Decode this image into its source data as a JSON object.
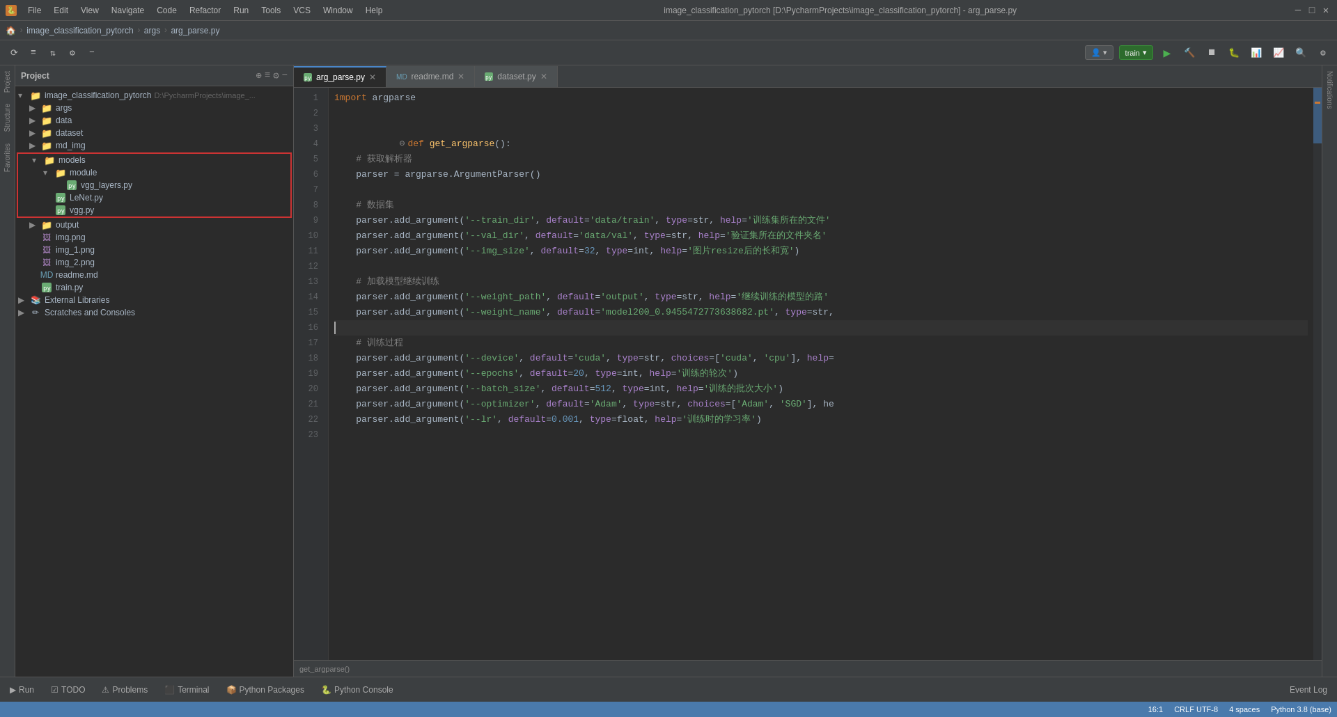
{
  "window": {
    "title": "image_classification_pytorch [D:\\PycharmProjects\\image_classification_pytorch] - arg_parse.py",
    "icon": "🐍"
  },
  "menus": [
    "File",
    "Edit",
    "View",
    "Navigate",
    "Code",
    "Refactor",
    "Run",
    "Tools",
    "VCS",
    "Window",
    "Help"
  ],
  "breadcrumb": {
    "items": [
      "image_classification_pytorch",
      "args",
      "arg_parse.py"
    ]
  },
  "toolbar": {
    "run_config": "train",
    "buttons": [
      "▶",
      "🔄",
      "⏹",
      "🐛",
      "📊"
    ]
  },
  "tabs": [
    {
      "label": "arg_parse.py",
      "active": true,
      "icon": "py"
    },
    {
      "label": "readme.md",
      "active": false,
      "icon": "md"
    },
    {
      "label": "dataset.py",
      "active": false,
      "icon": "py"
    }
  ],
  "project": {
    "title": "Project",
    "root": {
      "name": "image_classification_pytorch",
      "path": "D:\\PycharmProjects\\image_...",
      "children": [
        {
          "name": "args",
          "type": "folder",
          "expanded": false
        },
        {
          "name": "data",
          "type": "folder",
          "expanded": false
        },
        {
          "name": "dataset",
          "type": "folder",
          "expanded": false
        },
        {
          "name": "md_img",
          "type": "folder",
          "expanded": false
        },
        {
          "name": "models",
          "type": "folder",
          "expanded": true,
          "highlighted": true,
          "children": [
            {
              "name": "module",
              "type": "folder",
              "expanded": true,
              "children": [
                {
                  "name": "vgg_layers.py",
                  "type": "py"
                }
              ]
            },
            {
              "name": "LeNet.py",
              "type": "py"
            },
            {
              "name": "vgg.py",
              "type": "py"
            }
          ]
        },
        {
          "name": "output",
          "type": "folder",
          "expanded": false
        },
        {
          "name": "img.png",
          "type": "png"
        },
        {
          "name": "img_1.png",
          "type": "png"
        },
        {
          "name": "img_2.png",
          "type": "png"
        },
        {
          "name": "readme.md",
          "type": "md"
        },
        {
          "name": "train.py",
          "type": "py"
        }
      ]
    },
    "external_libraries": "External Libraries",
    "scratches": "Scratches and Consoles"
  },
  "code": {
    "lines": [
      {
        "num": 1,
        "content": "import argparse",
        "tokens": [
          {
            "t": "kw",
            "v": "import"
          },
          {
            "t": "plain",
            "v": " argparse"
          }
        ]
      },
      {
        "num": 2,
        "content": "",
        "tokens": []
      },
      {
        "num": 3,
        "content": "",
        "tokens": []
      },
      {
        "num": 4,
        "content": "def get_argparse():",
        "tokens": [
          {
            "t": "kw",
            "v": "def"
          },
          {
            "t": "plain",
            "v": " "
          },
          {
            "t": "fn",
            "v": "get_argparse"
          },
          {
            "t": "plain",
            "v": "():"
          }
        ]
      },
      {
        "num": 5,
        "content": "    # 获取解析器",
        "tokens": [
          {
            "t": "plain",
            "v": "    "
          },
          {
            "t": "cmt",
            "v": "# 获取解析器"
          }
        ]
      },
      {
        "num": 6,
        "content": "    parser = argparse.ArgumentParser()",
        "tokens": [
          {
            "t": "plain",
            "v": "    parser = argparse.ArgumentParser()"
          }
        ]
      },
      {
        "num": 7,
        "content": "",
        "tokens": []
      },
      {
        "num": 8,
        "content": "    # 数据集",
        "tokens": [
          {
            "t": "plain",
            "v": "    "
          },
          {
            "t": "cmt",
            "v": "# 数据集"
          }
        ]
      },
      {
        "num": 9,
        "content": "    parser.add_argument('--train_dir', default='data/train', type=str, help='训练集所在的文件'",
        "tokens": [
          {
            "t": "plain",
            "v": "    parser.add_argument("
          },
          {
            "t": "str",
            "v": "'--train_dir'"
          },
          {
            "t": "plain",
            "v": ", "
          },
          {
            "t": "param",
            "v": "default"
          },
          {
            "t": "plain",
            "v": "="
          },
          {
            "t": "str",
            "v": "'data/train'"
          },
          {
            "t": "plain",
            "v": ", "
          },
          {
            "t": "param",
            "v": "type"
          },
          {
            "t": "plain",
            "v": "=str, "
          },
          {
            "t": "param",
            "v": "help"
          },
          {
            "t": "plain",
            "v": "="
          },
          {
            "t": "str",
            "v": "'训练集所在的文件'"
          }
        ]
      },
      {
        "num": 10,
        "content": "    parser.add_argument('--val_dir', default='data/val', type=str, help='验证集所在的文件夹名'",
        "tokens": [
          {
            "t": "plain",
            "v": "    parser.add_argument("
          },
          {
            "t": "str",
            "v": "'--val_dir'"
          },
          {
            "t": "plain",
            "v": ", "
          },
          {
            "t": "param",
            "v": "default"
          },
          {
            "t": "plain",
            "v": "="
          },
          {
            "t": "str",
            "v": "'data/val'"
          },
          {
            "t": "plain",
            "v": ", "
          },
          {
            "t": "param",
            "v": "type"
          },
          {
            "t": "plain",
            "v": "=str, "
          },
          {
            "t": "param",
            "v": "help"
          },
          {
            "t": "plain",
            "v": "="
          },
          {
            "t": "str",
            "v": "'验证集所在的文件夹名'"
          }
        ]
      },
      {
        "num": 11,
        "content": "    parser.add_argument('--img_size', default=32, type=int, help='图片resize后的长和宽')",
        "tokens": [
          {
            "t": "plain",
            "v": "    parser.add_argument("
          },
          {
            "t": "str",
            "v": "'--img_size'"
          },
          {
            "t": "plain",
            "v": ", "
          },
          {
            "t": "param",
            "v": "default"
          },
          {
            "t": "plain",
            "v": "="
          },
          {
            "t": "num",
            "v": "32"
          },
          {
            "t": "plain",
            "v": ", "
          },
          {
            "t": "param",
            "v": "type"
          },
          {
            "t": "plain",
            "v": "=int, "
          },
          {
            "t": "param",
            "v": "help"
          },
          {
            "t": "plain",
            "v": "="
          },
          {
            "t": "str",
            "v": "'图片resize后的长和宽'"
          },
          {
            "t": "plain",
            "v": ")"
          }
        ]
      },
      {
        "num": 12,
        "content": "",
        "tokens": []
      },
      {
        "num": 13,
        "content": "    # 加载模型继续训练",
        "tokens": [
          {
            "t": "plain",
            "v": "    "
          },
          {
            "t": "cmt",
            "v": "# 加载模型继续训练"
          }
        ]
      },
      {
        "num": 14,
        "content": "    parser.add_argument('--weight_path', default='output', type=str, help='继续训练的模型的路'",
        "tokens": [
          {
            "t": "plain",
            "v": "    parser.add_argument("
          },
          {
            "t": "str",
            "v": "'--weight_path'"
          },
          {
            "t": "plain",
            "v": ", "
          },
          {
            "t": "param",
            "v": "default"
          },
          {
            "t": "plain",
            "v": "="
          },
          {
            "t": "str",
            "v": "'output'"
          },
          {
            "t": "plain",
            "v": ", "
          },
          {
            "t": "param",
            "v": "type"
          },
          {
            "t": "plain",
            "v": "=str, "
          },
          {
            "t": "param",
            "v": "help"
          },
          {
            "t": "plain",
            "v": "="
          },
          {
            "t": "str",
            "v": "'继续训练的模型的路'"
          }
        ]
      },
      {
        "num": 15,
        "content": "    parser.add_argument('--weight_name', default='model200_0.9455472773638682.pt', type=str,",
        "tokens": [
          {
            "t": "plain",
            "v": "    parser.add_argument("
          },
          {
            "t": "str",
            "v": "'--weight_name'"
          },
          {
            "t": "plain",
            "v": ", "
          },
          {
            "t": "param",
            "v": "default"
          },
          {
            "t": "plain",
            "v": "="
          },
          {
            "t": "str",
            "v": "'model200_0.9455472773638682.pt'"
          },
          {
            "t": "plain",
            "v": ", "
          },
          {
            "t": "param",
            "v": "type"
          },
          {
            "t": "plain",
            "v": "=str,"
          }
        ]
      },
      {
        "num": 16,
        "content": "",
        "tokens": [],
        "current": true
      },
      {
        "num": 17,
        "content": "    # 训练过程",
        "tokens": [
          {
            "t": "plain",
            "v": "    "
          },
          {
            "t": "cmt",
            "v": "# 训练过程"
          }
        ]
      },
      {
        "num": 18,
        "content": "    parser.add_argument('--device', default='cuda', type=str, choices=['cuda', 'cpu'], help=",
        "tokens": [
          {
            "t": "plain",
            "v": "    parser.add_argument("
          },
          {
            "t": "str",
            "v": "'--device'"
          },
          {
            "t": "plain",
            "v": ", "
          },
          {
            "t": "param",
            "v": "default"
          },
          {
            "t": "plain",
            "v": "="
          },
          {
            "t": "str",
            "v": "'cuda'"
          },
          {
            "t": "plain",
            "v": ", "
          },
          {
            "t": "param",
            "v": "type"
          },
          {
            "t": "plain",
            "v": "=str, "
          },
          {
            "t": "param",
            "v": "choices"
          },
          {
            "t": "plain",
            "v": "=["
          },
          {
            "t": "str",
            "v": "'cuda'"
          },
          {
            "t": "plain",
            "v": ", "
          },
          {
            "t": "str",
            "v": "'cpu'"
          },
          {
            "t": "plain",
            "v": "], "
          },
          {
            "t": "param",
            "v": "help"
          },
          {
            "t": "plain",
            "v": "="
          }
        ]
      },
      {
        "num": 19,
        "content": "    parser.add_argument('--epochs', default=20, type=int, help='训练的轮次')",
        "tokens": [
          {
            "t": "plain",
            "v": "    parser.add_argument("
          },
          {
            "t": "str",
            "v": "'--epochs'"
          },
          {
            "t": "plain",
            "v": ", "
          },
          {
            "t": "param",
            "v": "default"
          },
          {
            "t": "plain",
            "v": "="
          },
          {
            "t": "num",
            "v": "20"
          },
          {
            "t": "plain",
            "v": ", "
          },
          {
            "t": "param",
            "v": "type"
          },
          {
            "t": "plain",
            "v": "=int, "
          },
          {
            "t": "param",
            "v": "help"
          },
          {
            "t": "plain",
            "v": "="
          },
          {
            "t": "str",
            "v": "'训练的轮次'"
          },
          {
            "t": "plain",
            "v": ")"
          }
        ]
      },
      {
        "num": 20,
        "content": "    parser.add_argument('--batch_size', default=512, type=int, help='训练的批次大小')",
        "tokens": [
          {
            "t": "plain",
            "v": "    parser.add_argument("
          },
          {
            "t": "str",
            "v": "'--batch_size'"
          },
          {
            "t": "plain",
            "v": ", "
          },
          {
            "t": "param",
            "v": "default"
          },
          {
            "t": "plain",
            "v": "="
          },
          {
            "t": "num",
            "v": "512"
          },
          {
            "t": "plain",
            "v": ", "
          },
          {
            "t": "param",
            "v": "type"
          },
          {
            "t": "plain",
            "v": "=int, "
          },
          {
            "t": "param",
            "v": "help"
          },
          {
            "t": "plain",
            "v": "="
          },
          {
            "t": "str",
            "v": "'训练的批次大小'"
          },
          {
            "t": "plain",
            "v": ")"
          }
        ]
      },
      {
        "num": 21,
        "content": "    parser.add_argument('--optimizer', default='Adam', type=str, choices=['Adam', 'SGD'], he",
        "tokens": [
          {
            "t": "plain",
            "v": "    parser.add_argument("
          },
          {
            "t": "str",
            "v": "'--optimizer'"
          },
          {
            "t": "plain",
            "v": ", "
          },
          {
            "t": "param",
            "v": "default"
          },
          {
            "t": "plain",
            "v": "="
          },
          {
            "t": "str",
            "v": "'Adam'"
          },
          {
            "t": "plain",
            "v": ", "
          },
          {
            "t": "param",
            "v": "type"
          },
          {
            "t": "plain",
            "v": "=str, "
          },
          {
            "t": "param",
            "v": "choices"
          },
          {
            "t": "plain",
            "v": "=["
          },
          {
            "t": "str",
            "v": "'Adam'"
          },
          {
            "t": "plain",
            "v": ", "
          },
          {
            "t": "str",
            "v": "'SGD'"
          },
          {
            "t": "plain",
            "v": "], he"
          }
        ]
      },
      {
        "num": 22,
        "content": "    parser.add_argument('--lr', default=0.001, type=float, help='训练时的学习率')",
        "tokens": [
          {
            "t": "plain",
            "v": "    parser.add_argument("
          },
          {
            "t": "str",
            "v": "'--lr'"
          },
          {
            "t": "plain",
            "v": ", "
          },
          {
            "t": "param",
            "v": "default"
          },
          {
            "t": "plain",
            "v": "="
          },
          {
            "t": "num",
            "v": "0.001"
          },
          {
            "t": "plain",
            "v": ", "
          },
          {
            "t": "param",
            "v": "type"
          },
          {
            "t": "plain",
            "v": "=float, "
          },
          {
            "t": "param",
            "v": "help"
          },
          {
            "t": "plain",
            "v": "="
          },
          {
            "t": "str",
            "v": "'训练时的学习率'"
          },
          {
            "t": "plain",
            "v": ")"
          }
        ]
      },
      {
        "num": 23,
        "content": "",
        "tokens": []
      }
    ]
  },
  "bottom_tabs": [
    {
      "label": "Run",
      "icon": "▶",
      "active": false
    },
    {
      "label": "TODO",
      "icon": "☑",
      "active": false
    },
    {
      "label": "Problems",
      "icon": "⚠",
      "active": false
    },
    {
      "label": "Terminal",
      "icon": "⬛",
      "active": false
    },
    {
      "label": "Python Packages",
      "icon": "📦",
      "active": false
    },
    {
      "label": "Python Console",
      "icon": "🐍",
      "active": false
    }
  ],
  "status_bar": {
    "left": "Event Log",
    "line_col": "16:1",
    "encoding": "CRLF  UTF-8",
    "indent": "4 spaces",
    "interpreter": "Python 3.8 (base)"
  },
  "bottom_breadcrumb": "get_argparse()",
  "left_strips": [
    "Project",
    "Structure",
    "Favorites"
  ],
  "right_strips": [
    "Notifications"
  ]
}
